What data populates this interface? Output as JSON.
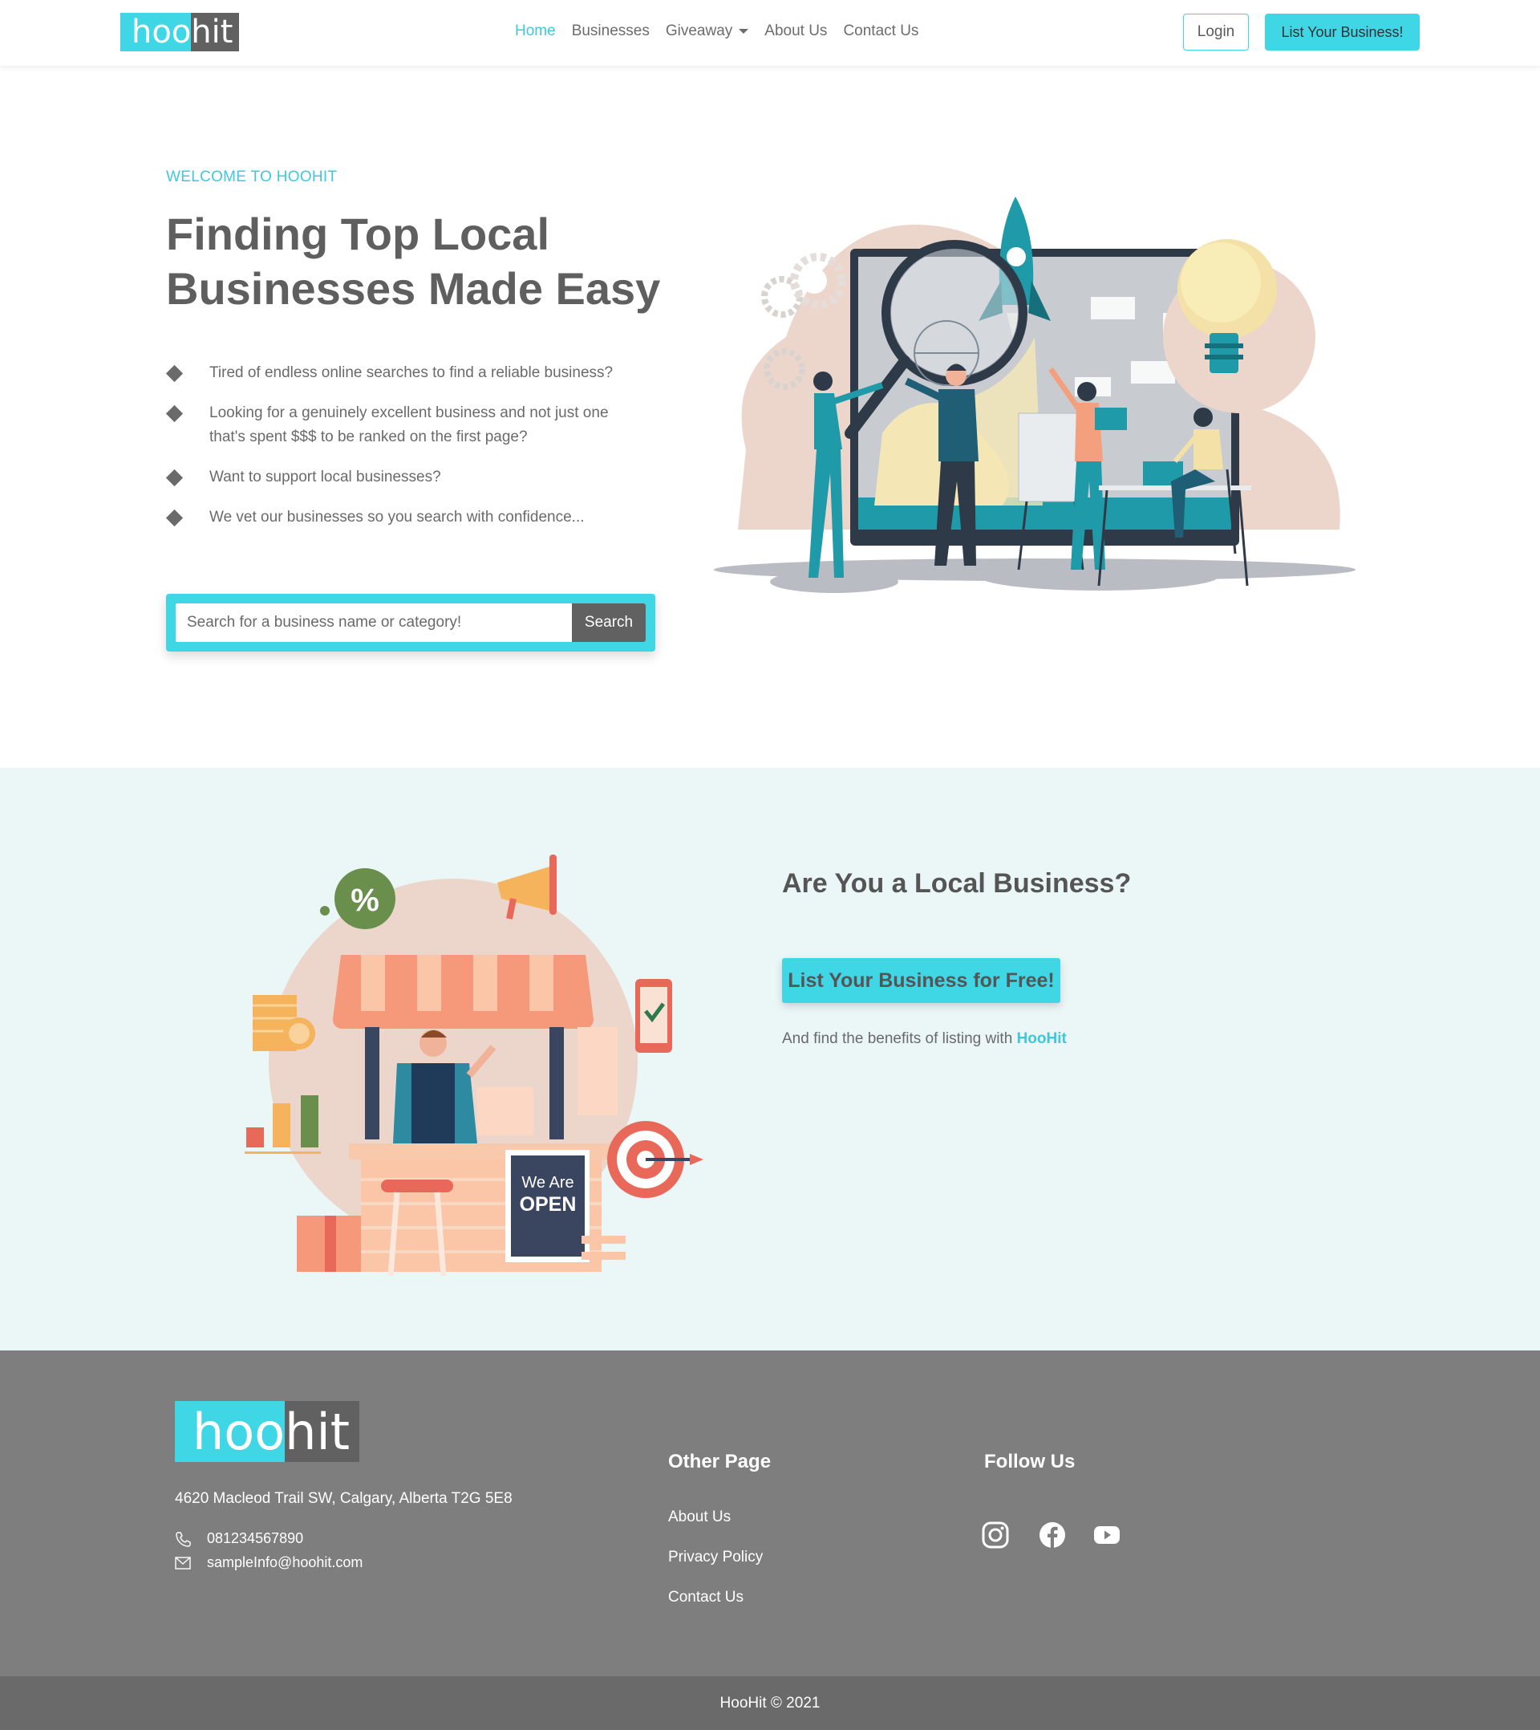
{
  "brand": {
    "logo_hoo": "hoo",
    "logo_hit": "hit",
    "accent": "#3fd6e6",
    "dark": "#616161"
  },
  "nav": {
    "links": [
      {
        "label": "Home",
        "active": true
      },
      {
        "label": "Businesses"
      },
      {
        "label": "Giveaway"
      },
      {
        "label": "About Us"
      },
      {
        "label": "Contact Us"
      }
    ],
    "login_label": "Login",
    "list_label": "List Your Business!"
  },
  "hero": {
    "eyebrow": "WELCOME TO HOOHIT",
    "title": "Finding Top Local Businesses Made Easy",
    "bullets": [
      "Tired of endless online searches to find a reliable business?",
      "Looking for a genuinely excellent business and not just one that's spent $$$ to be ranked on the first page?",
      "Want to support local businesses?",
      "We vet our businesses so you search with confidence..."
    ],
    "search": {
      "placeholder": "Search for a business name or category!",
      "button": "Search"
    }
  },
  "local": {
    "title": "Are You a Local Business?",
    "cta": "List Your Business for Free!",
    "subtitle_prefix": "And find the benefits of listing with",
    "subtitle_brand": "HooHit",
    "sign_line1": "We Are",
    "sign_line2": "OPEN"
  },
  "footer": {
    "address": "4620 Macleod Trail SW, Calgary, Alberta T2G 5E8",
    "phone": "081234567890",
    "email": "sampleInfo@hoohit.com",
    "other_heading": "Other Page",
    "other_links": [
      "About Us",
      "Privacy Policy",
      "Contact Us"
    ],
    "follow_heading": "Follow Us",
    "social_icons": [
      "instagram-icon",
      "facebook-icon",
      "youtube-icon"
    ],
    "copyright": "HooHit © 2021"
  }
}
